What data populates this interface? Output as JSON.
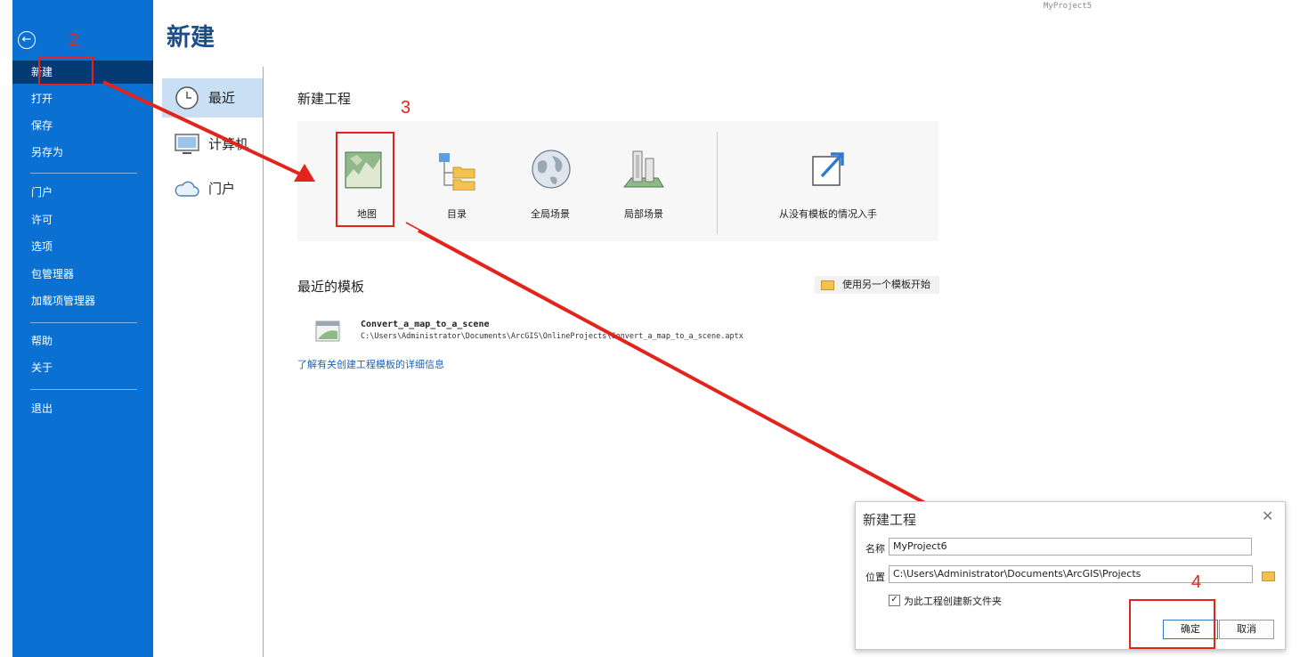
{
  "app": {
    "project_hint": "MyProject5"
  },
  "sidebar": {
    "items": [
      {
        "label": "新建"
      },
      {
        "label": "打开"
      },
      {
        "label": "保存"
      },
      {
        "label": "另存为"
      },
      {
        "label": "门户"
      },
      {
        "label": "许可"
      },
      {
        "label": "选项"
      },
      {
        "label": "包管理器"
      },
      {
        "label": "加载项管理器"
      },
      {
        "label": "帮助"
      },
      {
        "label": "关于"
      },
      {
        "label": "退出"
      }
    ]
  },
  "page": {
    "title": "新建"
  },
  "categories": [
    {
      "label": "最近",
      "icon": "clock-icon"
    },
    {
      "label": "计算机",
      "icon": "computer-icon"
    },
    {
      "label": "门户",
      "icon": "cloud-icon"
    }
  ],
  "new_project": {
    "title": "新建工程",
    "tiles": [
      {
        "label": "地图",
        "icon": "map-icon"
      },
      {
        "label": "目录",
        "icon": "catalog-icon"
      },
      {
        "label": "全局场景",
        "icon": "globe-icon"
      },
      {
        "label": "局部场景",
        "icon": "local-scene-icon"
      }
    ],
    "blank_label": "从没有模板的情况入手"
  },
  "recent_templates": {
    "title": "最近的模板",
    "other_template_button": "使用另一个模板开始",
    "items": [
      {
        "name": "Convert_a_map_to_a_scene",
        "path": "C:\\Users\\Administrator\\Documents\\ArcGIS\\OnlineProjects\\Convert_a_map_to_a_scene.aptx"
      }
    ],
    "learn_more_link": "了解有关创建工程模板的详细信息"
  },
  "annotations": {
    "n2": "2",
    "n3": "3",
    "n4": "4"
  },
  "dialog": {
    "title": "新建工程",
    "name_label": "名称",
    "name_value": "MyProject6",
    "location_label": "位置",
    "location_value": "C:\\Users\\Administrator\\Documents\\ArcGIS\\Projects",
    "checkbox_label": "为此工程创建新文件夹",
    "checkbox_checked": true,
    "ok_label": "确定",
    "cancel_label": "取消"
  },
  "colors": {
    "sidebar": "#0a70d1",
    "sidebar_active": "#053b75",
    "annotation_red": "#e3241c",
    "accent_title": "#1c4f8a"
  }
}
